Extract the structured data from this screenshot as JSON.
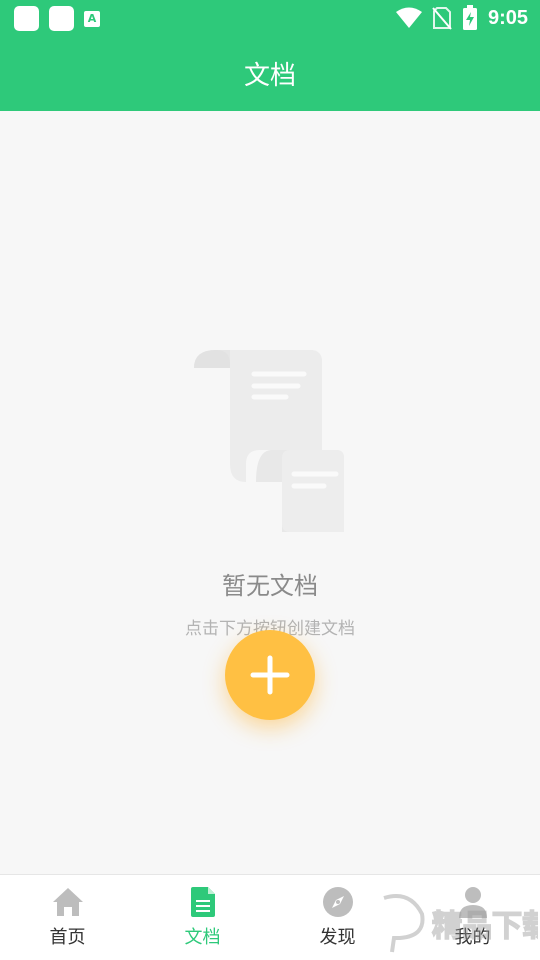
{
  "status_bar": {
    "time": "9:05",
    "left_icons": [
      "app-icon",
      "app-icon",
      "a-keyboard-icon"
    ],
    "right_icons": [
      "wifi-icon",
      "no-sim-icon",
      "battery-charging-icon"
    ]
  },
  "app_bar": {
    "title": "文档"
  },
  "empty_state": {
    "illustration": "document-scroll-icon",
    "title": "暂无文档",
    "hint": "点击下方按钮创建文档"
  },
  "fab": {
    "icon": "plus-icon"
  },
  "bottom_nav": {
    "items": [
      {
        "label": "首页",
        "icon": "home-icon",
        "active": false
      },
      {
        "label": "文档",
        "icon": "document-icon",
        "active": true
      },
      {
        "label": "发现",
        "icon": "compass-icon",
        "active": false
      },
      {
        "label": "我的",
        "icon": "person-icon",
        "active": false
      }
    ]
  },
  "watermark": {
    "text": "精品下载"
  },
  "colors": {
    "primary_green": "#2ec97a",
    "fab_yellow": "#ffc043",
    "background": "#f7f7f7",
    "inactive_icon": "#bdbdbd"
  }
}
